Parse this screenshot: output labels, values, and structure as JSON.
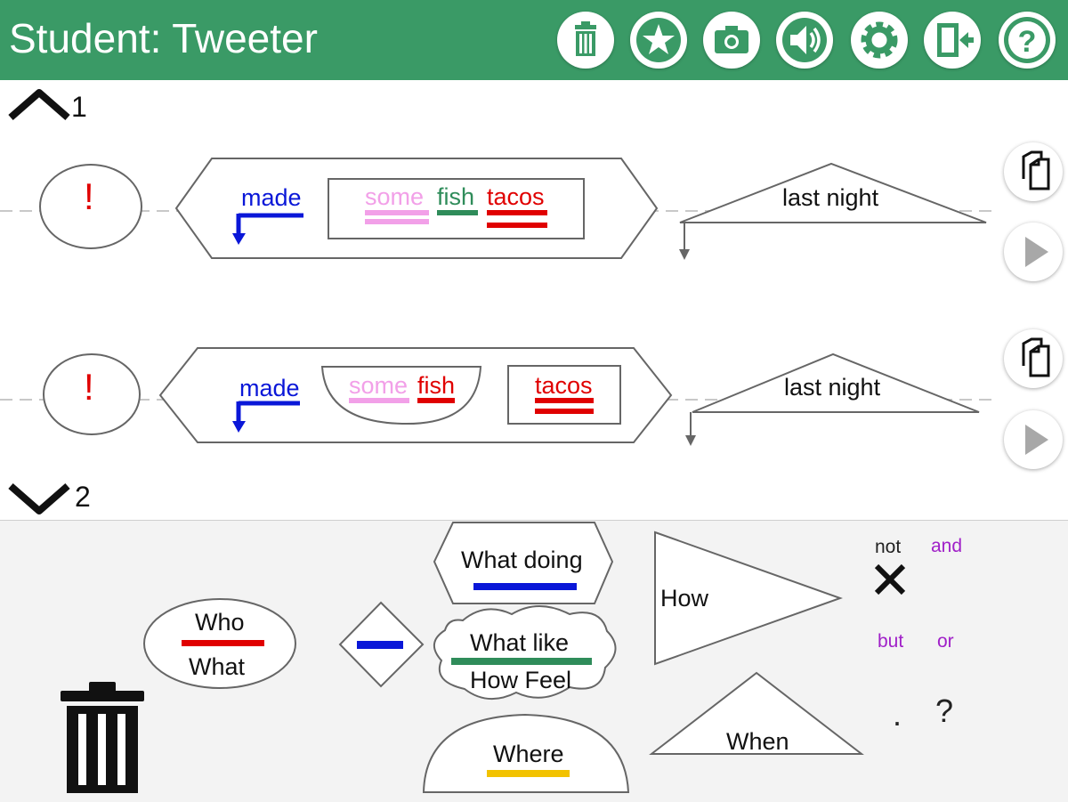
{
  "header": {
    "title": "Student: Tweeter",
    "buttons": [
      "trash-icon",
      "star-icon",
      "camera-icon",
      "speaker-icon",
      "gear-icon",
      "exit-icon",
      "help-icon"
    ]
  },
  "colors": {
    "header": "#3a9a66",
    "verb": "#0a17d8",
    "noun": "#e00000",
    "article": "#f2a0e8",
    "adjective": "#2f8c5a",
    "where": "#f2c200",
    "conjunction": "#a020c8"
  },
  "nav": {
    "up_number": "1",
    "down_number": "2"
  },
  "sentences": [
    {
      "mark": "!",
      "verb": "made",
      "words": [
        "some",
        "fish",
        "tacos"
      ],
      "when": "last night"
    },
    {
      "mark": "!",
      "verb": "made",
      "words": [
        "some",
        "fish",
        "tacos"
      ],
      "when": "last night"
    }
  ],
  "palette": {
    "who": "Who",
    "what": "What",
    "what_doing": "What doing",
    "what_like": "What like",
    "how_feel": "How Feel",
    "where": "Where",
    "how": "How",
    "when": "When",
    "not": "not",
    "and": "and",
    "but": "but",
    "or": "or",
    "period": ".",
    "question": "?"
  }
}
